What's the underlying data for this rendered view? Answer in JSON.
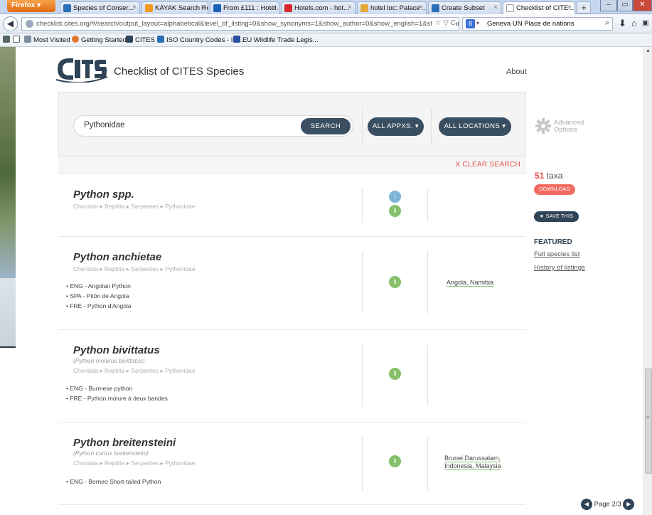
{
  "browser": {
    "menu_label": "Firefox ▾",
    "tabs": [
      {
        "label": "Species of Conser...",
        "color": "#2a6fb5"
      },
      {
        "label": "KAYAK Search Re...",
        "color": "#f29b21"
      },
      {
        "label": "From £111 : Hotel...",
        "color": "#1b5fb8"
      },
      {
        "label": "Hotels.com - hot...",
        "color": "#d7262c"
      },
      {
        "label": "hotel loc: Palace ...",
        "color": "#e1a93a"
      },
      {
        "label": "Create Subset",
        "color": "#2a6fb5"
      },
      {
        "label": "Checklist of CITE...",
        "color": "#ffffff"
      }
    ],
    "new_tab_label": "+",
    "url": "checklist.cites.org/#/search/output_layout=alphabetical&level_of_listing=0&show_synonyms=1&show_author=0&show_english=1&show_spanis",
    "url_controls": "☆ ▽ C",
    "search_engine_query": "Geneva UN Place de nations",
    "bookmarks": [
      {
        "label": "Most Visited",
        "color": "#7d8b9d"
      },
      {
        "label": "Getting Started",
        "color": "#e0752b"
      },
      {
        "label": "CITES",
        "color": "#2f4456"
      },
      {
        "label": "ISO Country Codes - IS...",
        "color": "#2a6fb5"
      },
      {
        "label": "EU Wildlife Trade Legis...",
        "color": "#2b4fa3"
      }
    ]
  },
  "site": {
    "title": "Checklist of CITES Species",
    "about": "About"
  },
  "search": {
    "query": "Pythonidae",
    "search_button": "SEARCH",
    "appendix_filter": "ALL APPXS. ▾",
    "location_filter": "ALL LOCATIONS ▾",
    "advanced_line1": "Advanced",
    "advanced_line2": "Options",
    "clear": "X CLEAR SEARCH"
  },
  "results": [
    {
      "name": "Python spp.",
      "synonym": "",
      "taxonomy": [
        "Chordata",
        "Reptilia",
        "Serpentes",
        "Pythonidae"
      ],
      "common": [],
      "appendices": [
        "I",
        "II"
      ],
      "locations": ""
    },
    {
      "name": "Python anchietae",
      "synonym": "",
      "taxonomy": [
        "Chordata",
        "Reptilia",
        "Serpentes",
        "Pythonidae"
      ],
      "common": [
        "• ENG - Angolan Python",
        "• SPA - Pitón de Angola",
        "• FRE - Python d'Angola"
      ],
      "appendices": [
        "II"
      ],
      "locations": "Angola, Namibia"
    },
    {
      "name": "Python bivittatus",
      "synonym": "(Python molurus bivittatus)",
      "taxonomy": [
        "Chordata",
        "Reptilia",
        "Serpentes",
        "Pythonidae"
      ],
      "common": [
        "• ENG - Burmese python",
        "• FRE - Python molure à deux bandes"
      ],
      "appendices": [
        "II"
      ],
      "locations": ""
    },
    {
      "name": "Python breitensteini",
      "synonym": "(Python curtus breitensteini)",
      "taxonomy": [
        "Chordata",
        "Reptilia",
        "Serpentes",
        "Pythonidae"
      ],
      "common": [
        "• ENG - Borneo Short-tailed Python"
      ],
      "appendices": [
        "II"
      ],
      "locations_line1": "Brunei Darussalam,",
      "locations_line2": "Indonesia, Malaysia"
    }
  ],
  "sidebar": {
    "count_number": "51",
    "count_label": " taxa",
    "download": "DOWNLOAD",
    "save": "★ SAVE THIS",
    "featured_heading": "FEATURED",
    "featured_links": [
      "Full species list",
      "History of listings"
    ]
  },
  "pager": {
    "label": "Page 2/3"
  },
  "colors": {
    "navy": "#3a4e61",
    "accent_red": "#e4504f",
    "appendix_I": "#7fb4d8",
    "appendix_II": "#86c06a"
  }
}
